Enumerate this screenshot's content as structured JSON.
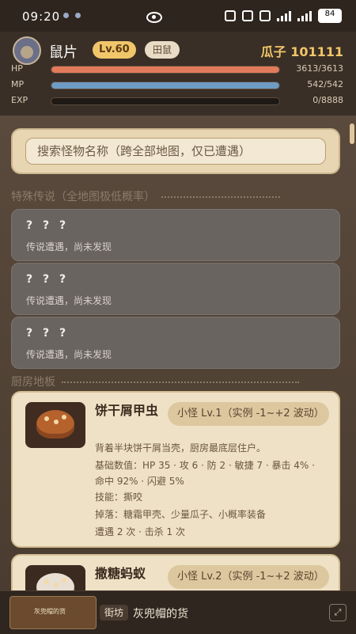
{
  "status_bar": {
    "time": "09:20",
    "battery": "84"
  },
  "player": {
    "name": "鼠片",
    "level": "Lv.60",
    "class": "田鼠",
    "coins_label": "瓜子 101111"
  },
  "stats": {
    "hp": {
      "label": "HP",
      "value": "3613/3613",
      "fraction": 1.0,
      "color": "#e27b5a"
    },
    "mp": {
      "label": "MP",
      "value": "542/542",
      "fraction": 1.0,
      "color": "#6e9cc2"
    },
    "exp": {
      "label": "EXP",
      "value": "0/8888",
      "fraction": 0.0,
      "color": "#c9a24a"
    }
  },
  "search": {
    "placeholder": "搜索怪物名称（跨全部地图，仅已遭遇）"
  },
  "sections": {
    "legend": "特殊传说（全地图极低概率）",
    "kitchen": "厨房地板"
  },
  "unknown_items": [
    {
      "title": "? ? ?",
      "subtitle": "传说遭遇，尚未发现"
    },
    {
      "title": "? ? ?",
      "subtitle": "传说遭遇，尚未发现"
    },
    {
      "title": "? ? ?",
      "subtitle": "传说遭遇，尚未发现"
    }
  ],
  "monsters": [
    {
      "name": "饼干屑甲虫",
      "tag": "小怪 Lv.1（实例 -1~+2 波动）",
      "desc": "背着半块饼干屑当壳，厨房最底层住户。",
      "stats": "基础数值：HP 35 · 攻 6 · 防 2 · 敏捷 7 · 暴击 4% · 命中 92% · 闪避 5%",
      "skills": "技能：撕咬",
      "drops": "掉落：糖霜甲壳、少量瓜子、小概率装备",
      "record": "遭遇 2 次 · 击杀 1 次"
    },
    {
      "name": "撒糖蚂蚁",
      "tag": "小怪 Lv.2（实例 -1~+2 波动）"
    }
  ],
  "bottom_bar": {
    "thumb_text": "灰兜帽的货",
    "location": "街坊",
    "title": "灰兜帽的货",
    "expand_icon": "expand-icon"
  }
}
